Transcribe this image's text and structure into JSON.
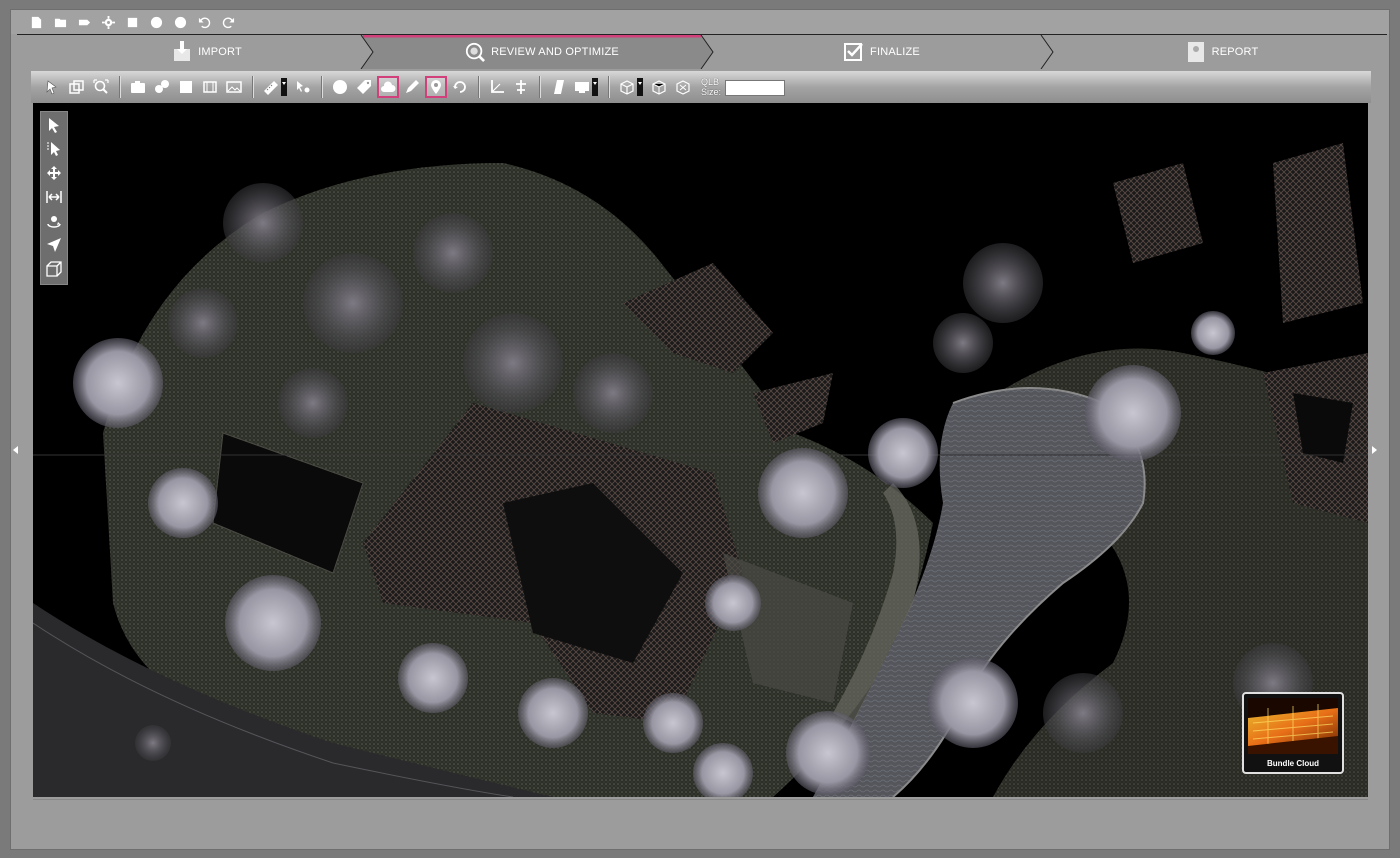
{
  "window": {
    "titlebar_icons": [
      "new-file-icon",
      "open-file-icon",
      "tag-icon",
      "settings-icon",
      "square-icon",
      "circle-icon",
      "circle-icon",
      "undo-icon",
      "redo-icon"
    ]
  },
  "steps": [
    {
      "label": "IMPORT",
      "icon": "import-icon",
      "active": false
    },
    {
      "label": "REVIEW AND OPTIMIZE",
      "icon": "magnifier-icon",
      "active": true
    },
    {
      "label": "FINALIZE",
      "icon": "check-icon",
      "active": false
    },
    {
      "label": "REPORT",
      "icon": "report-icon",
      "active": false
    }
  ],
  "toolbar": {
    "qlb_label": "QLB",
    "size_label": "Size:",
    "size_value": ""
  },
  "viewport": {
    "bundle_label": "Bundle Cloud"
  },
  "colors": {
    "accent": "#d1407a",
    "viewport_bg": "#000000"
  }
}
